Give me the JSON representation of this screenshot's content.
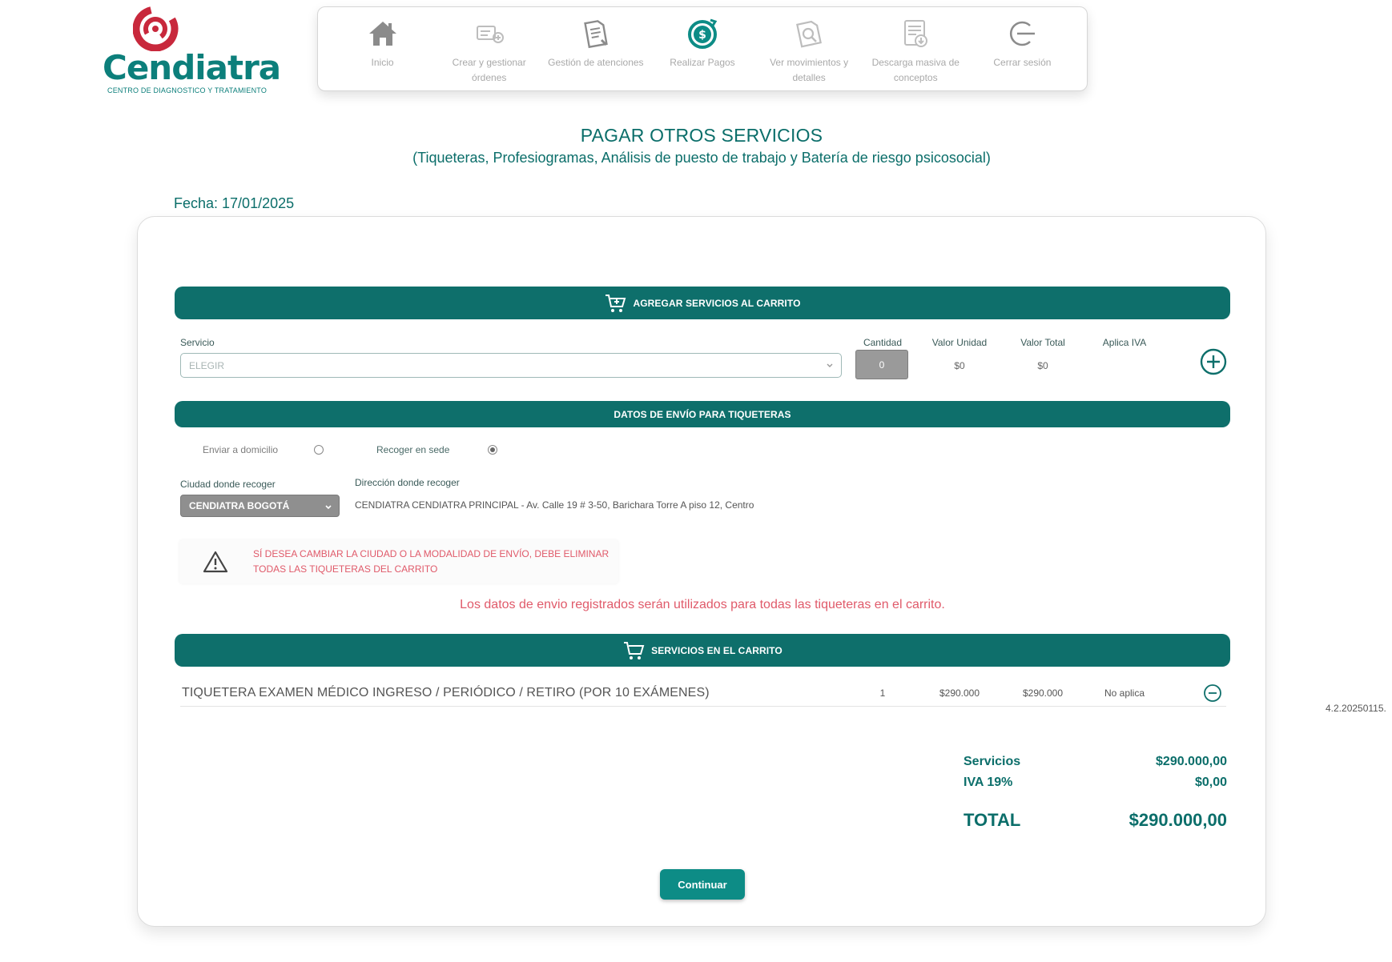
{
  "logo": {
    "name": "Cendiatra",
    "tagline": "CENTRO DE DIAGNOSTICO Y TRATAMIENTO"
  },
  "nav": [
    {
      "label": "Inicio",
      "icon": "home-icon",
      "active": false
    },
    {
      "label": "Crear y gestionar órdenes",
      "icon": "orders-icon",
      "active": false
    },
    {
      "label": "Gestión de atenciones",
      "icon": "clipboard-icon",
      "active": false
    },
    {
      "label": "Realizar Pagos",
      "icon": "payment-icon",
      "active": true
    },
    {
      "label": "Ver movimientos y detalles",
      "icon": "search-document-icon",
      "active": false
    },
    {
      "label": "Descarga masiva de conceptos",
      "icon": "download-icon",
      "active": false
    },
    {
      "label": "Cerrar sesión",
      "icon": "logout-icon",
      "active": false
    }
  ],
  "page": {
    "title": "PAGAR OTROS SERVICIOS",
    "subtitle": "(Tiqueteras, Profesiogramas, Análisis de puesto de trabajo y Batería de riesgo psicosocial)",
    "fecha": "Fecha: 17/01/2025"
  },
  "add_section": {
    "header": "AGREGAR SERVICIOS AL CARRITO",
    "col_servicio": "Servicio",
    "col_cantidad": "Cantidad",
    "col_valor_unidad": "Valor Unidad",
    "col_valor_total": "Valor Total",
    "col_aplica_iva": "Aplica IVA",
    "servicio_placeholder": "ELEGIR",
    "cantidad": "0",
    "valor_unidad": "$0",
    "valor_total": "$0"
  },
  "shipping": {
    "header": "DATOS DE ENVÍO PARA TIQUETERAS",
    "option_domicilio": "Enviar a domicilio",
    "option_sede": "Recoger en sede",
    "selected": "sede",
    "city_label": "Ciudad donde recoger",
    "city_value": "CENDIATRA BOGOTÁ",
    "address_label": "Dirección donde recoger",
    "address_value": "CENDIATRA CENDIATRA PRINCIPAL - Av. Calle 19 # 3-50, Barichara Torre A piso 12, Centro",
    "warning": "SÍ DESEA CAMBIAR LA CIUDAD O LA MODALIDAD DE ENVÍO, DEBE ELIMINAR TODAS LAS TIQUETERAS DEL CARRITO",
    "note": "Los datos de envio registrados serán utilizados para todas las tiqueteras en el carrito."
  },
  "cart": {
    "header": "SERVICIOS EN EL CARRITO",
    "items": [
      {
        "name": "TIQUETERA EXAMEN MÉDICO INGRESO / PERIÓDICO / RETIRO (POR 10 EXÁMENES)",
        "cantidad": "1",
        "valor_unidad": "$290.000",
        "valor_total": "$290.000",
        "aplica_iva": "No aplica"
      }
    ]
  },
  "totals": {
    "servicios_label": "Servicios",
    "servicios_value": "$290.000,00",
    "iva_label": "IVA 19%",
    "iva_value": "$0,00",
    "total_label": "TOTAL",
    "total_value": "$290.000,00"
  },
  "actions": {
    "continuar": "Continuar"
  },
  "version": "4.2.20250115.",
  "colors": {
    "brand_teal": "#0e6f6b",
    "accent_teal": "#0d8c86",
    "brand_red": "#c8283c",
    "warning_red": "#e05a6a"
  }
}
